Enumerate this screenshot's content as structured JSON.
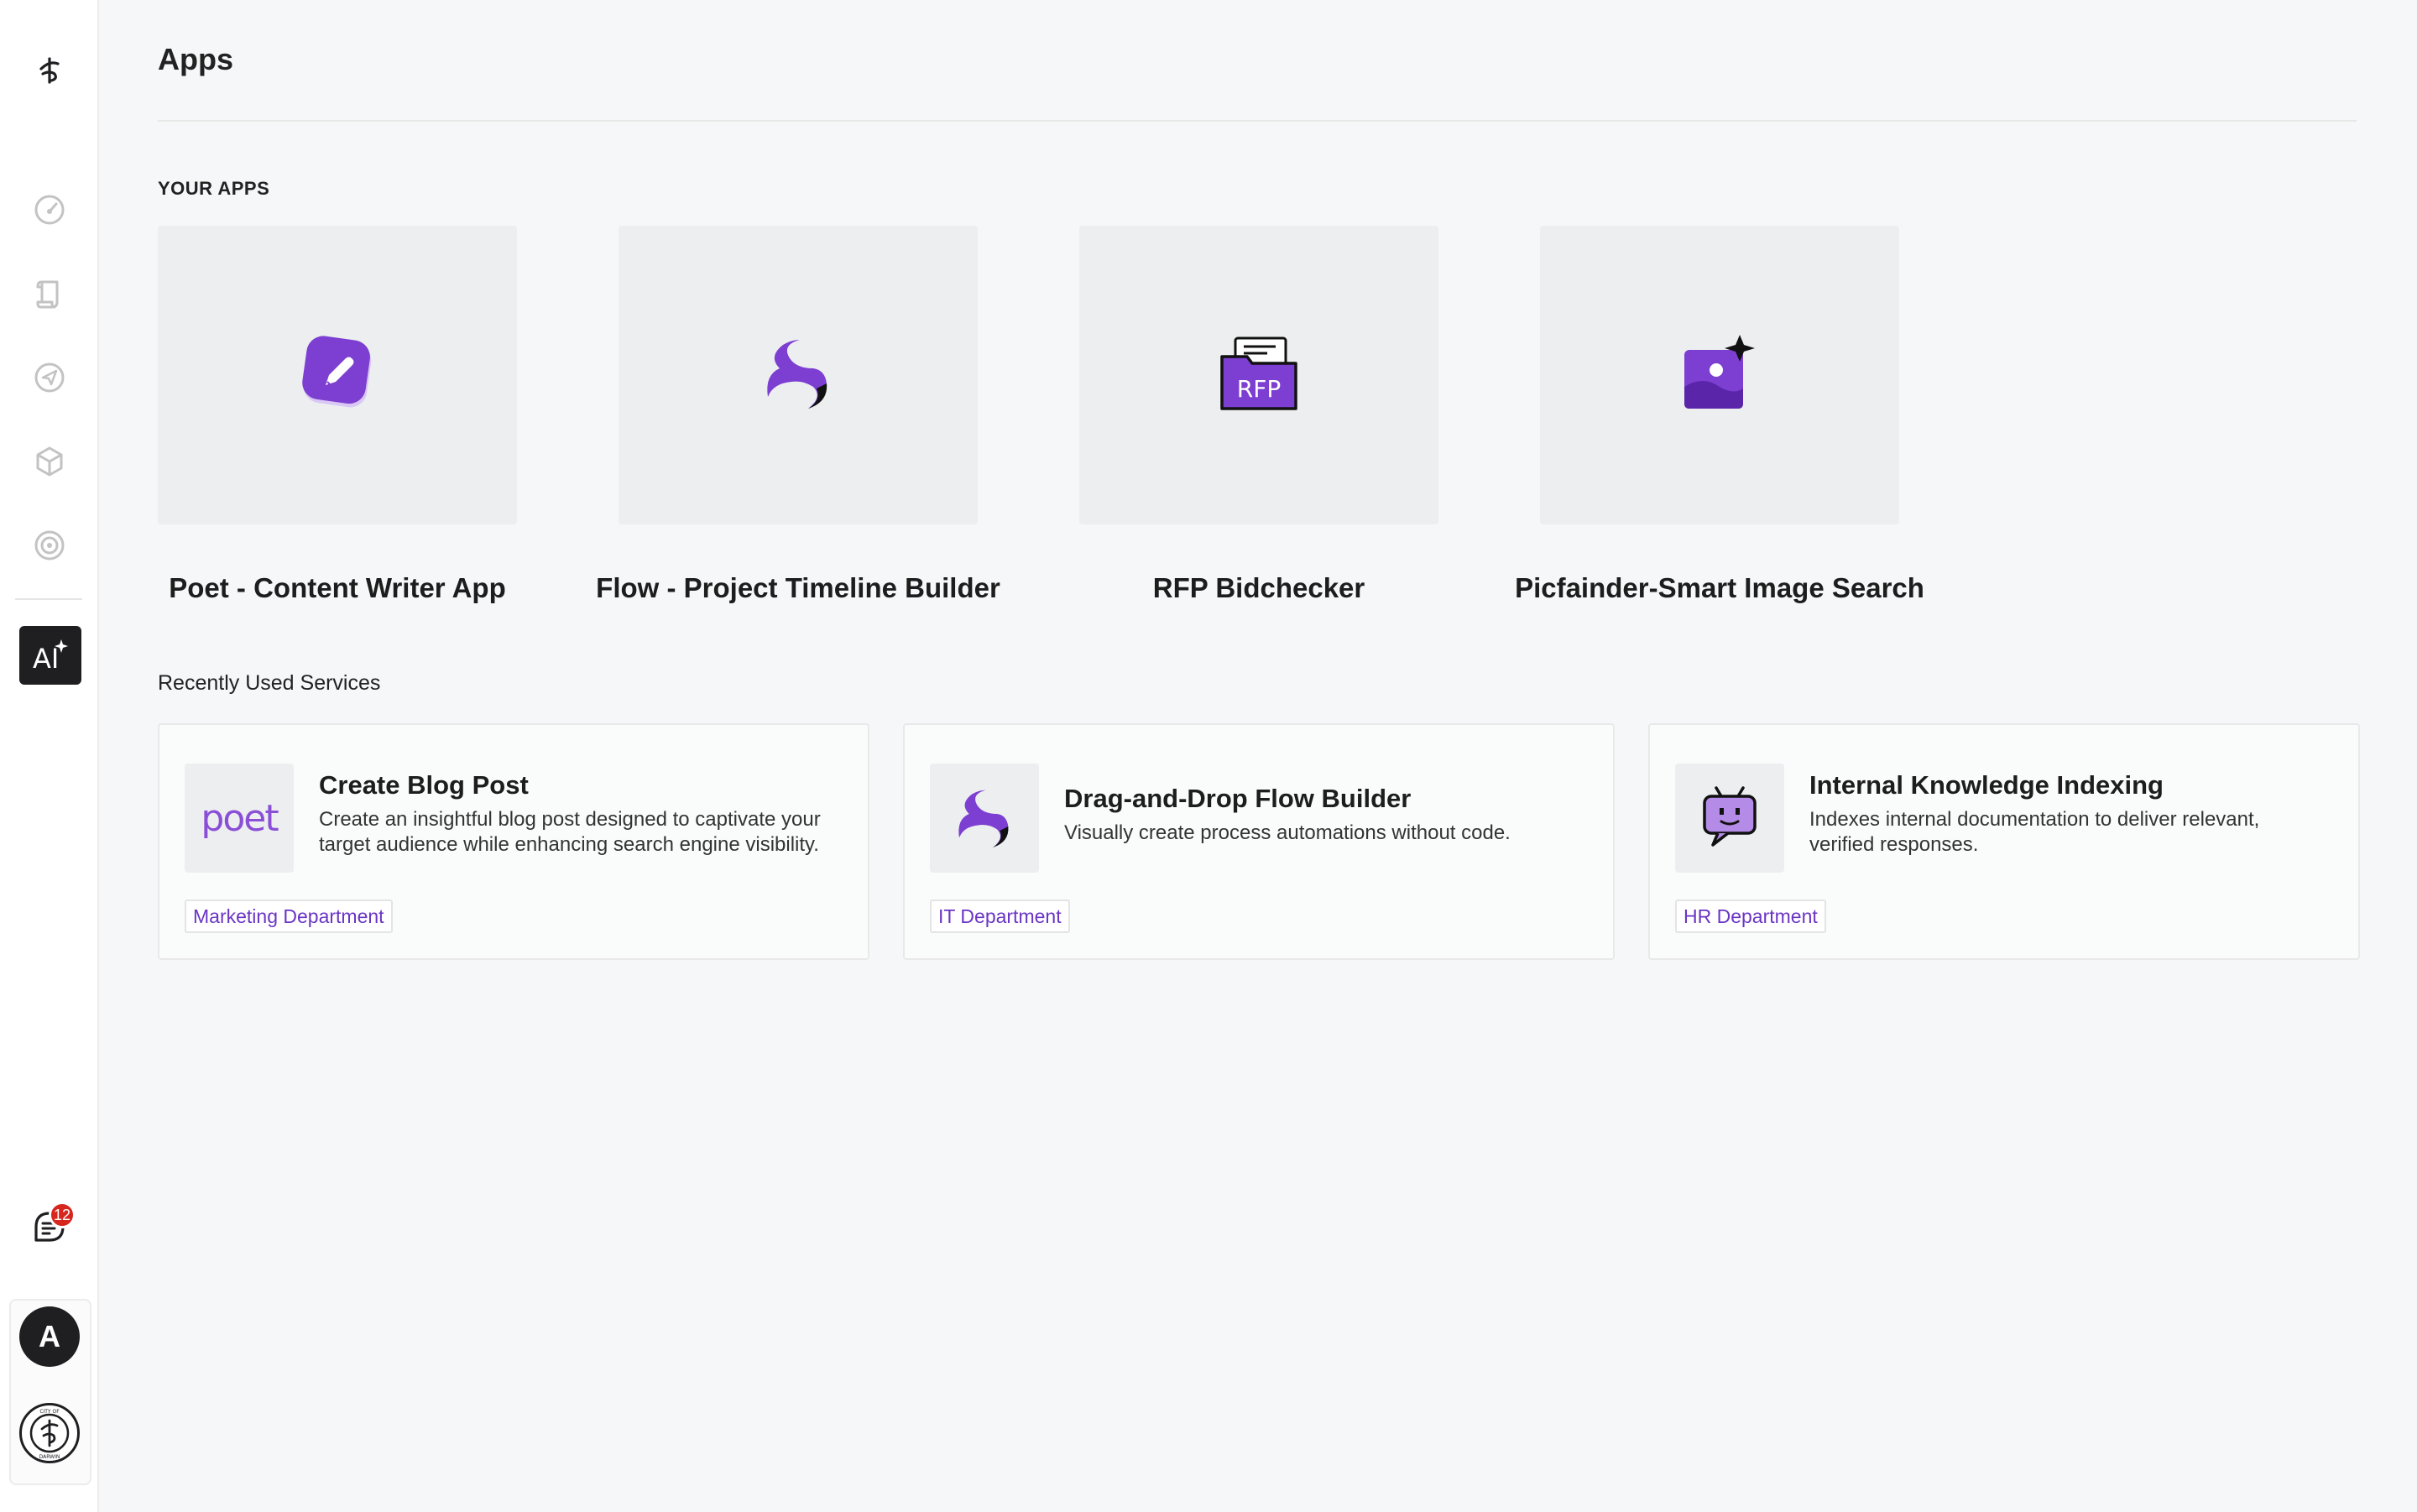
{
  "page": {
    "title": "Apps"
  },
  "sidebar": {
    "logo_icon": "brand-logo-icon",
    "items": [
      {
        "icon": "speedometer-icon"
      },
      {
        "icon": "scroll-icon"
      },
      {
        "icon": "send-icon"
      },
      {
        "icon": "cube-icon"
      },
      {
        "icon": "target-icon"
      },
      {
        "icon": "ai-apps-icon",
        "active": true
      }
    ],
    "notifications": {
      "icon": "chat-notification-icon",
      "count": "12"
    },
    "user": {
      "avatar_letter": "A"
    },
    "org": {
      "name": "City of Darwin",
      "logo_text_top": "CITY OF",
      "logo_text_bottom": "DARWIN"
    }
  },
  "your_apps": {
    "label": "YOUR APPS",
    "apps": [
      {
        "name": "Poet - Content Writer App",
        "icon": "pencil-badge-icon"
      },
      {
        "name": "Flow - Project Timeline Builder",
        "icon": "swirl-logo-icon"
      },
      {
        "name": "RFP Bidchecker",
        "icon": "rfp-folder-icon",
        "icon_text": "RFP"
      },
      {
        "name": "Picfainder-Smart Image Search",
        "icon": "image-sparkle-icon"
      }
    ]
  },
  "recent_services": {
    "label": "Recently Used Services",
    "items": [
      {
        "title": "Create Blog Post",
        "description": "Create an insightful blog post designed to captivate your target audience while enhancing search engine visibility.",
        "department": "Marketing Department",
        "thumb": "poet-wordmark-icon",
        "thumb_text": "poet"
      },
      {
        "title": "Drag-and-Drop Flow Builder",
        "description": "Visually create process automations without code.",
        "department": "IT Department",
        "thumb": "swirl-logo-icon"
      },
      {
        "title": "Internal Knowledge Indexing",
        "description": "Indexes internal documentation to deliver relevant, verified responses.",
        "department": "HR Department",
        "thumb": "robot-chat-icon"
      }
    ]
  },
  "colors": {
    "accent": "#6b35c5",
    "badge": "#d7261e",
    "dark": "#1f1f22"
  }
}
